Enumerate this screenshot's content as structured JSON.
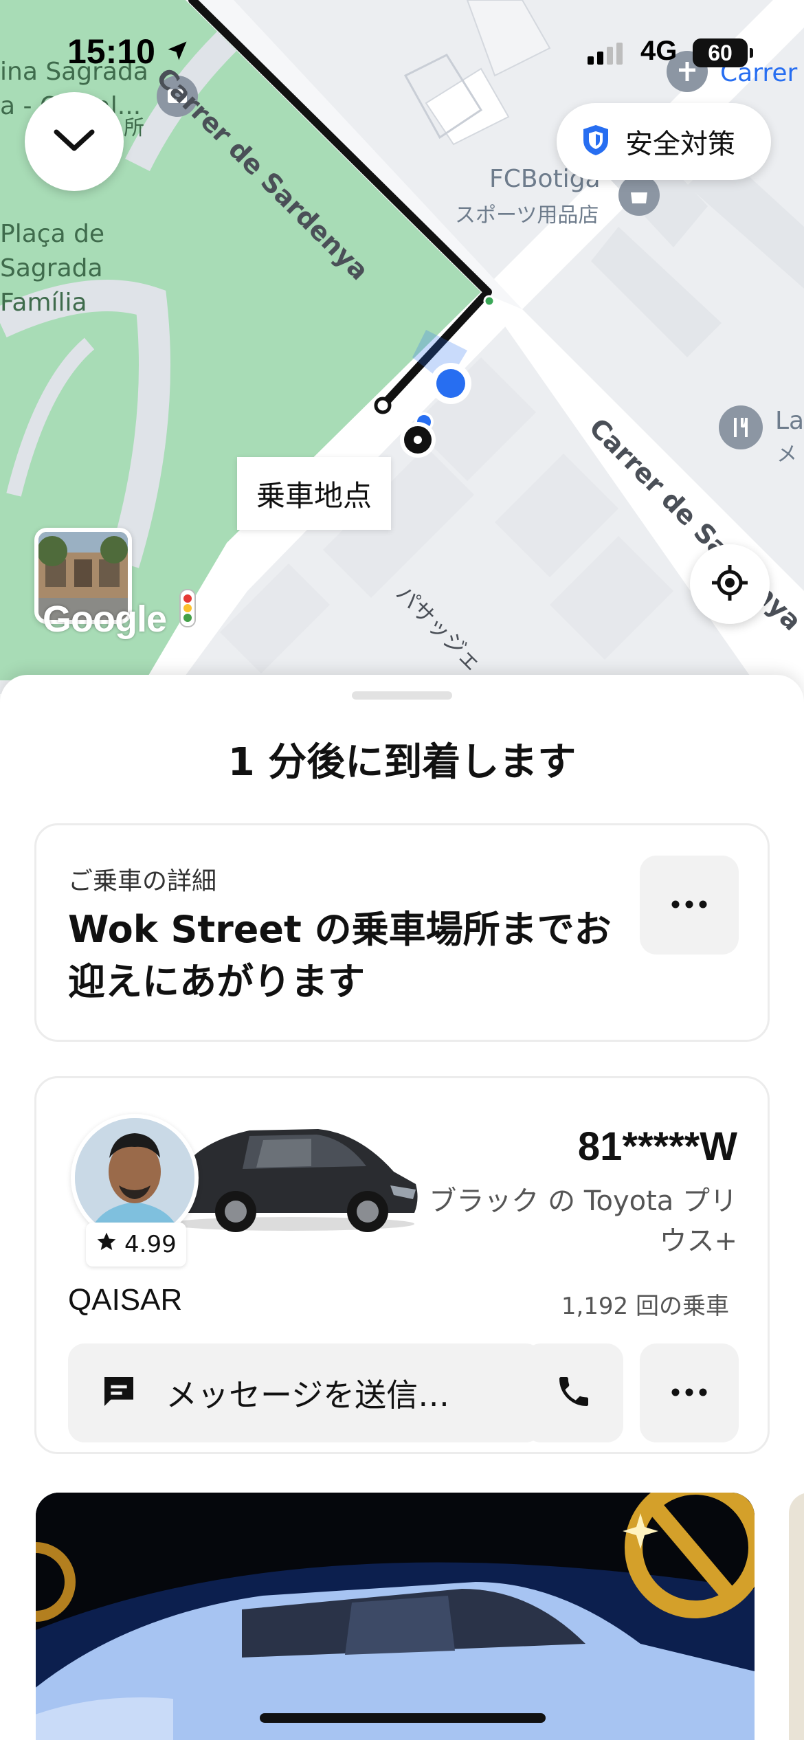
{
  "status_bar": {
    "time": "15:10",
    "network": "4G",
    "battery": "60"
  },
  "map": {
    "labels": {
      "sagrada_top_1": "ina Sagrada",
      "sagrada_top_2": "a - Oficial...",
      "sagrada_top_3": "所",
      "placa_1": "Plaça de",
      "placa_2": "Sagrada",
      "placa_3": "Família",
      "shop_name": "FCBotiga",
      "shop_category": "スポーツ用品店",
      "street_diagonal": "Carrer de Sardenya",
      "street_right": "Carrer de Sardenya",
      "carrer_top_right": "Carrer d",
      "la_right": "La",
      "me_right": "メ",
      "passatge": "パサッジェ"
    },
    "safety_button": "安全対策",
    "pickup_tag": "乗車地点",
    "google_logo": "Google"
  },
  "sheet": {
    "eta_title": "1 分後に到着します",
    "details": {
      "caption": "ご乗車の詳細",
      "title": "Wok Street の乗車場所までお迎えにあがります"
    },
    "driver": {
      "rating": "4.99",
      "plate": "81*****W",
      "vehicle": "ブラック の Toyota プリウス+",
      "name": "QAISAR",
      "trips": "1,192 回の乗車",
      "message_button": "メッセージを送信…"
    }
  },
  "colors": {
    "route": "#111111",
    "pickup_blue": "#276ef1",
    "park_green": "#a8dcb6",
    "safety_shield": "#276ef1"
  }
}
